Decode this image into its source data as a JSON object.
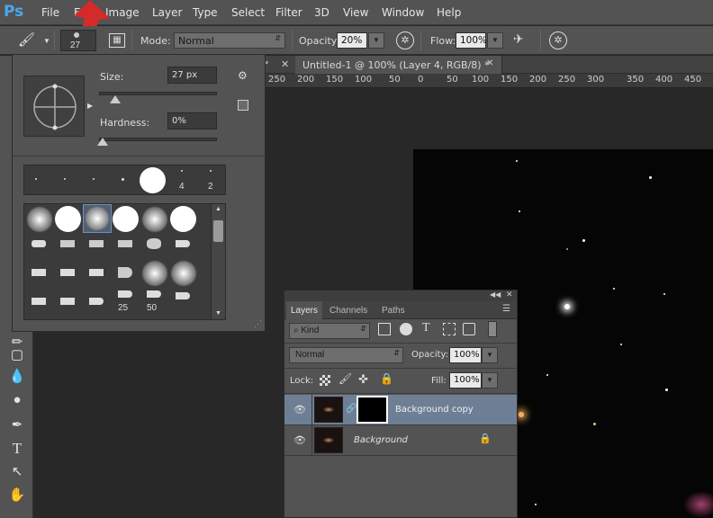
{
  "menubar": {
    "logo": "Ps",
    "items": [
      "File",
      "Edit",
      "Image",
      "Layer",
      "Type",
      "Select",
      "Filter",
      "3D",
      "View",
      "Window",
      "Help"
    ]
  },
  "options": {
    "brush_size": "27",
    "mode_label": "Mode:",
    "mode_value": "Normal",
    "opacity_label": "Opacity:",
    "opacity_value": "20%",
    "flow_label": "Flow:",
    "flow_value": "100%"
  },
  "doc_tab": {
    "title": "Untitled-1 @ 100% (Layer 4, RGB/8) *",
    "prev_tab_fragment": "*"
  },
  "ruler": {
    "ticks": [
      "250",
      "200",
      "150",
      "100",
      "50",
      "0",
      "50",
      "100",
      "150",
      "200",
      "250",
      "300",
      "350",
      "400",
      "450"
    ]
  },
  "brush_popup": {
    "size_label": "Size:",
    "size_value": "27 px",
    "hardness_label": "Hardness:",
    "hardness_value": "0%",
    "size_slider_fraction": 0.06,
    "hardness_slider_fraction": 0.0,
    "top_row_labels": [
      "",
      "",
      "",
      "",
      "",
      "4",
      "2"
    ],
    "grid_labels": [
      "25",
      "50"
    ]
  },
  "layers_panel": {
    "tabs": [
      "Layers",
      "Channels",
      "Paths"
    ],
    "active_tab": "Layers",
    "kind_filter": "Kind",
    "blend_mode": "Normal",
    "opacity_label": "Opacity:",
    "opacity_value": "100%",
    "lock_label": "Lock:",
    "fill_label": "Fill:",
    "fill_value": "100%",
    "layers": [
      {
        "name": "Background copy",
        "selected": true,
        "has_mask": true
      },
      {
        "name": "Background",
        "selected": false,
        "locked": true
      }
    ]
  },
  "colors": {
    "accent_red_arrow": "#d42a2a",
    "selected_layer": "#6e7f95",
    "ps_logo": "#4aa8ec"
  }
}
